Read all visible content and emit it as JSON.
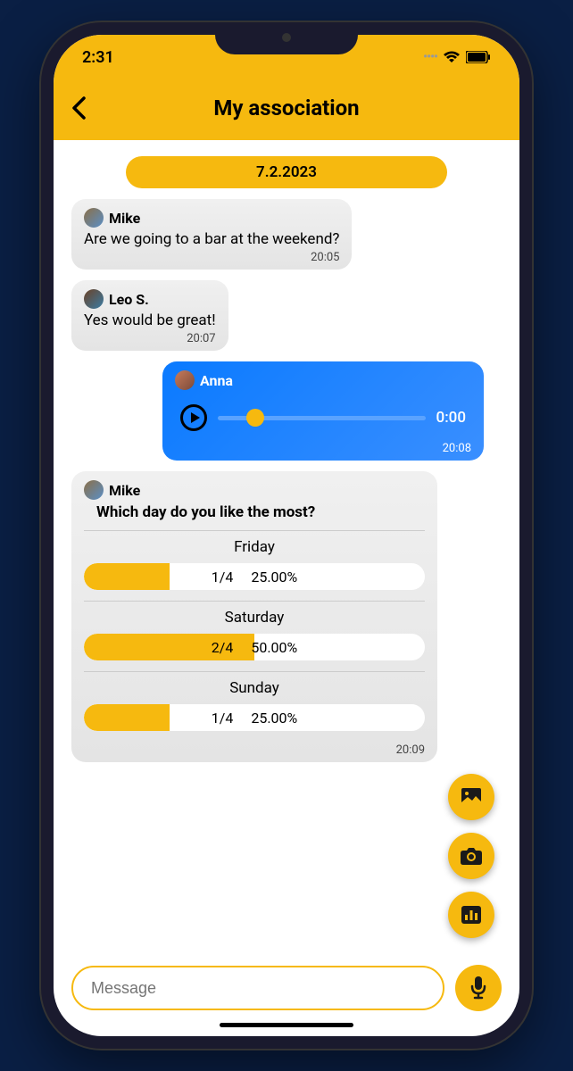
{
  "status": {
    "time": "2:31"
  },
  "header": {
    "title": "My association"
  },
  "date": "7.2.2023",
  "messages": [
    {
      "sender": "Mike",
      "text": "Are we going to a bar at the weekend?",
      "time": "20:05"
    },
    {
      "sender": "Leo S.",
      "text": "Yes would be great!",
      "time": "20:07"
    }
  ],
  "voice": {
    "sender": "Anna",
    "duration": "0:00",
    "time": "20:08"
  },
  "poll": {
    "sender": "Mike",
    "question": "Which day do you like the most?",
    "options": [
      {
        "label": "Friday",
        "count": "1/4",
        "percent": "25.00%",
        "fill": 25
      },
      {
        "label": "Saturday",
        "count": "2/4",
        "percent": "50.00%",
        "fill": 50
      },
      {
        "label": "Sunday",
        "count": "1/4",
        "percent": "25.00%",
        "fill": 25
      }
    ],
    "time": "20:09"
  },
  "input": {
    "placeholder": "Message"
  }
}
